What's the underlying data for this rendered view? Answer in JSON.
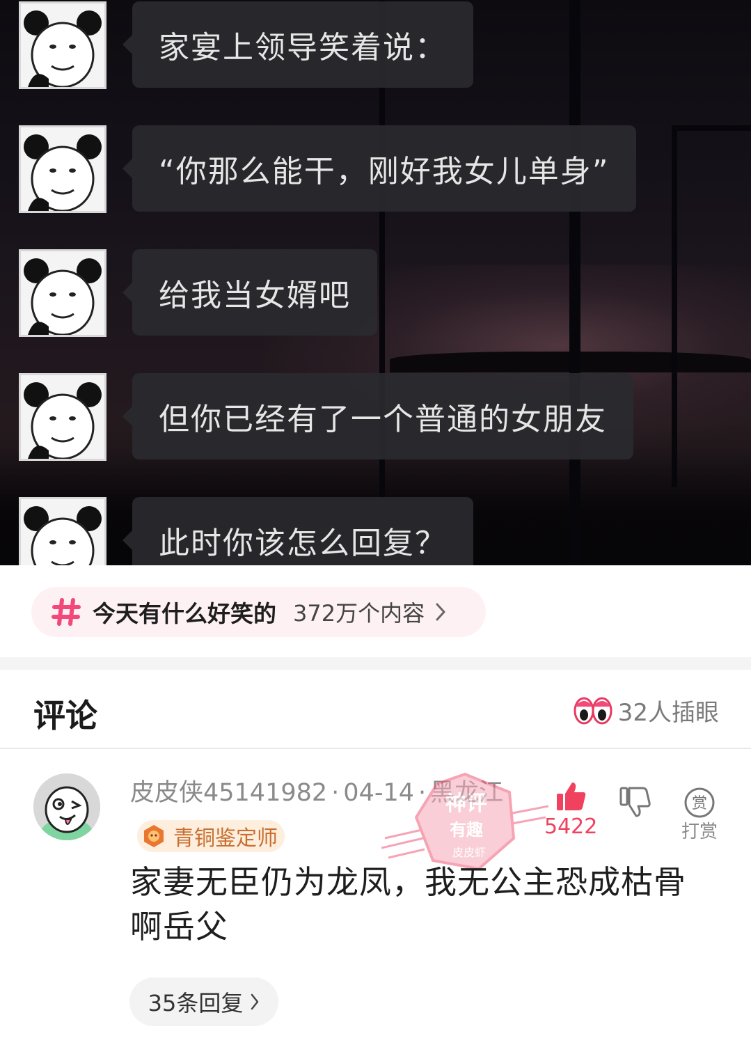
{
  "meme": {
    "messages": [
      "家宴上领导笑着说：",
      "“你那么能干，刚好我女儿单身”",
      "给我当女婿吧",
      "但你已经有了一个普通的女朋友",
      "此时你该怎么回复？"
    ]
  },
  "topic": {
    "name": "今天有什么好笑的",
    "count": "372万个内容",
    "accent": "#f2497a"
  },
  "comments_header": {
    "title": "评论",
    "peek_text": "32人插眼"
  },
  "comment": {
    "username": "皮皮侠45141982",
    "date": "04-14",
    "location": "黑龙江",
    "badge": "青铜鉴定师",
    "text": "家妻无臣仍为龙凤，我无公主恐成枯骨啊岳父",
    "likes": "5422",
    "tip_label": "打赏",
    "tip_icon_char": "赏",
    "replies": "35条回复",
    "stamp_lines": [
      "神评",
      "有趣",
      "皮皮虾"
    ]
  }
}
